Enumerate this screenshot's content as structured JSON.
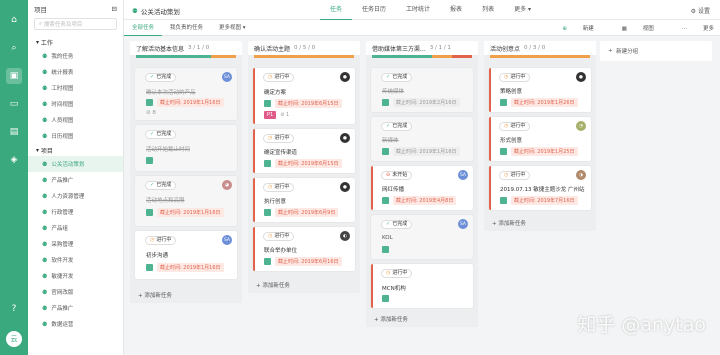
{
  "rail": {
    "icons": [
      "home-icon",
      "search-icon",
      "inbox-icon",
      "folder-icon",
      "calendar-icon",
      "cube-icon"
    ],
    "help": "?",
    "avatar": "云"
  },
  "sidebar": {
    "title": "项目",
    "search_placeholder": "搜索任务及项目",
    "groups": [
      {
        "label": "工作",
        "items": [
          "我的任务",
          "统计报表",
          "工时视图",
          "时间视图",
          "人员视图",
          "日历视图"
        ]
      },
      {
        "label": "项目",
        "items": [
          "公关活动策划",
          "产品推广",
          "人力资源管理",
          "行政管理",
          "产品组",
          "采购管理",
          "软件开发",
          "敏捷开发",
          "官网改版",
          "产品推广",
          "数据运营"
        ]
      }
    ]
  },
  "header": {
    "project": "公关活动策划",
    "tabs": [
      "任务",
      "任务日历",
      "工时统计",
      "报表",
      "列表",
      "更多"
    ],
    "active_tab": "任务",
    "settings": "设置"
  },
  "subbar": {
    "tabs": [
      "全部任务",
      "我负责的任务",
      "更多视图"
    ],
    "new": "新建",
    "view": "视图",
    "more": "更多"
  },
  "columns": [
    {
      "title": "了解活动基本信息",
      "count": "3 / 1 / 0",
      "cards": [
        {
          "status": "已完成",
          "title": "确认本次活动的产品",
          "deadline": "截止时间: 2019年1月16日",
          "done": true,
          "sub": "⊘ 8"
        },
        {
          "status": "已完成",
          "title": "活动开始截止时间",
          "deadline": "",
          "done": true
        },
        {
          "status": "已完成",
          "title": "活动地点和高限",
          "deadline": "截止时间: 2019年1月16日",
          "done": true
        },
        {
          "status": "进行中",
          "title": "初步沟通",
          "deadline": "截止时间: 2019年1月16日",
          "done": false
        }
      ],
      "add": "添加新任务"
    },
    {
      "title": "确认活动主题",
      "count": "0 / 5 / 0",
      "cards": [
        {
          "status": "进行中",
          "title": "确定方案",
          "deadline": "截止时间: 2019年6月15日",
          "done": false,
          "tag": "P1",
          "sub": "⊘ 1"
        },
        {
          "status": "进行中",
          "title": "确定宣传渠道",
          "deadline": "截止时间: 2019年6月15日",
          "done": false
        },
        {
          "status": "进行中",
          "title": "执行创意",
          "deadline": "截止时间: 2019年6月9日",
          "done": false
        },
        {
          "status": "进行中",
          "title": "联合举办单位",
          "deadline": "截止时间: 2019年6月16日",
          "done": false
        }
      ],
      "add": "添加新任务"
    },
    {
      "title": "借助媒体第三方渠...",
      "count": "3 / 1 / 1",
      "cards": [
        {
          "status": "已完成",
          "title": "传统媒体",
          "deadline": "截止时间: 2019年2月16日",
          "done": true
        },
        {
          "status": "已完成",
          "title": "新媒体",
          "deadline": "截止时间: 2019年1月16日",
          "done": true
        },
        {
          "status": "未开始",
          "title": "网红传播",
          "deadline": "截止时间: 2019年4月8日",
          "done": false
        },
        {
          "status": "已完成",
          "title": "KOL",
          "deadline": "",
          "done": true
        },
        {
          "status": "进行中",
          "title": "MCN机构",
          "deadline": "",
          "done": false
        }
      ],
      "add": "添加新任务"
    },
    {
      "title": "活动创意点",
      "count": "0 / 3 / 0",
      "cards": [
        {
          "status": "进行中",
          "title": "策略创意",
          "deadline": "截止时间: 2019年1月26日",
          "done": false
        },
        {
          "status": "进行中",
          "title": "形式创意",
          "deadline": "截止时间: 2019年1月25日",
          "done": false
        },
        {
          "status": "进行中",
          "title": "2019.07.13 敏捷主题沙龙 广州站",
          "deadline": "截止时间: 2019年7月16日",
          "done": false
        }
      ],
      "add": "添加新任务"
    }
  ],
  "new_group": "新建分组",
  "watermark": "知乎 @anytao",
  "colors": {
    "accent": "#3aa97e",
    "done": "#4db390",
    "doing": "#f0a04b",
    "todo": "#e2624b",
    "todo_bar": "#e2624b"
  }
}
